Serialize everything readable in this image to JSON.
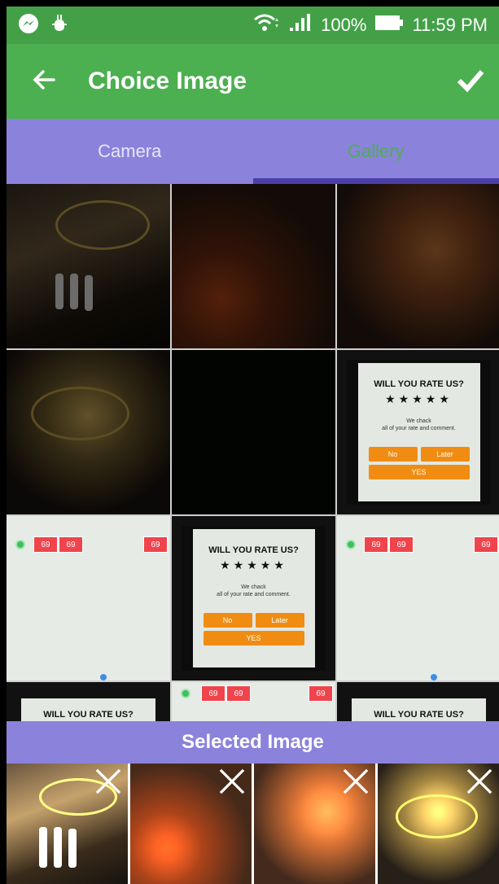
{
  "status_bar": {
    "battery": "100%",
    "time": "11:59 PM",
    "icons": [
      "messenger-icon",
      "android-debug-icon",
      "wifi-icon",
      "signal-icon",
      "battery-icon"
    ]
  },
  "app_bar": {
    "title": "Choice Image",
    "back_icon": "back-arrow-icon",
    "confirm_icon": "check-icon"
  },
  "tabs": [
    {
      "label": "Camera",
      "selected": false
    },
    {
      "label": "Gallery",
      "selected": true
    }
  ],
  "rate_dialog": {
    "title": "WILL YOU RATE US?",
    "stars": "★★★★★",
    "line1": "We chack",
    "line2": "all of your rate and comment.",
    "no": "No",
    "later": "Later",
    "yes": "YES"
  },
  "badge_value": "69",
  "selected_section": {
    "title": "Selected Image",
    "close_icon": "close-icon"
  },
  "colors": {
    "status_bar": "#43a047",
    "app_bar": "#4caf50",
    "tabs": "#8b82dc",
    "tab_indicator": "#4a3fa8",
    "gallery_tab_text": "#4caf50",
    "dialog_button": "#f08c12",
    "badge": "#f0444c"
  }
}
